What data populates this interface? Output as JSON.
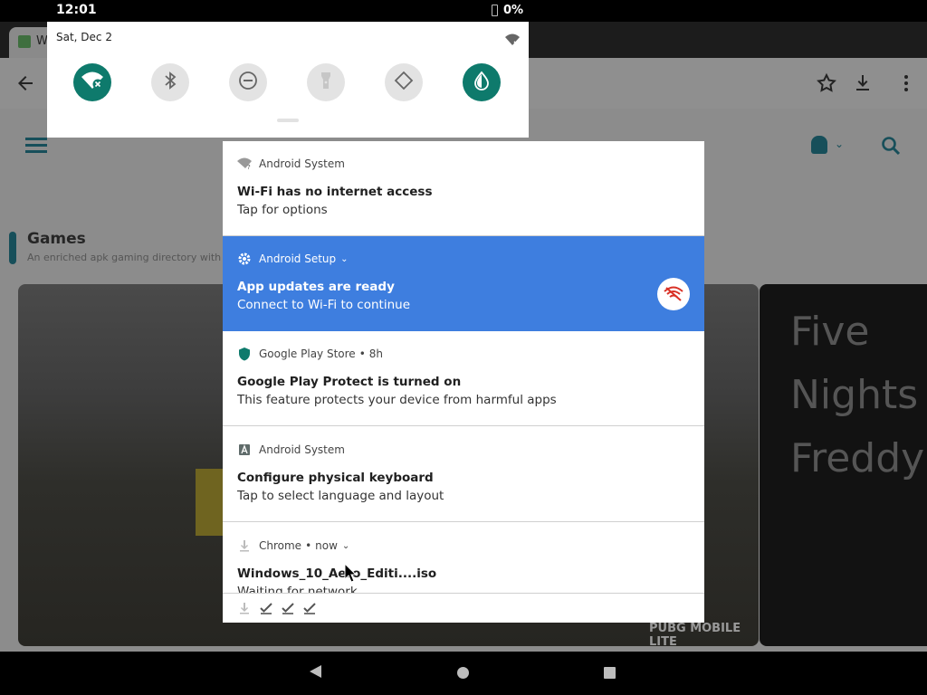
{
  "status_bar": {
    "time": "12:01",
    "battery": "0%"
  },
  "browser": {
    "tab_title": "W"
  },
  "page": {
    "games_title": "Games",
    "games_subtitle": "An enriched apk gaming directory with il",
    "card_label": "PUBG MOBILE LITE",
    "fnaf_title": "Five Nights at Freddy'"
  },
  "quick_settings": {
    "date": "Sat, Dec 2",
    "tiles": [
      {
        "name": "wifi",
        "icon": "wifi-off-icon",
        "active": true
      },
      {
        "name": "bluetooth",
        "icon": "bluetooth-icon",
        "active": false
      },
      {
        "name": "do-not-disturb",
        "icon": "do-not-disturb-icon",
        "active": false
      },
      {
        "name": "flashlight",
        "icon": "flashlight-icon",
        "active": false
      },
      {
        "name": "auto-rotate",
        "icon": "auto-rotate-icon",
        "active": false
      },
      {
        "name": "battery-saver",
        "icon": "battery-saver-icon",
        "active": true
      }
    ]
  },
  "notifications": [
    {
      "app": "Android System",
      "title": "Wi-Fi has no internet access",
      "body": "Tap for options",
      "icon": "wifi-question-icon",
      "highlighted": false
    },
    {
      "app": "Android Setup",
      "title": "App updates are ready",
      "body": "Connect to Wi-Fi to continue",
      "icon": "gear-icon",
      "highlighted": true,
      "expandable": true,
      "badge_icon": "wifi-off-icon"
    },
    {
      "app": "Google Play Store",
      "time": "8h",
      "title": "Google Play Protect is turned on",
      "body": "This feature protects your device from harmful apps",
      "icon": "shield-icon",
      "highlighted": false
    },
    {
      "app": "Android System",
      "title": "Configure physical keyboard",
      "body": "Tap to select language and layout",
      "icon": "keyboard-icon",
      "highlighted": false
    },
    {
      "app": "Chrome",
      "time": "now",
      "title": "Windows_10_Aero_Editi....iso",
      "body": "Waiting for network",
      "icon": "download-icon",
      "highlighted": false,
      "expandable": true
    }
  ],
  "action_icons": [
    "download-icon",
    "check-icon",
    "check-icon",
    "check-icon"
  ],
  "colors": {
    "accent_teal": "#0e7a6c",
    "highlight_blue": "#3e7edf",
    "page_dim": "#8c8c8c"
  }
}
